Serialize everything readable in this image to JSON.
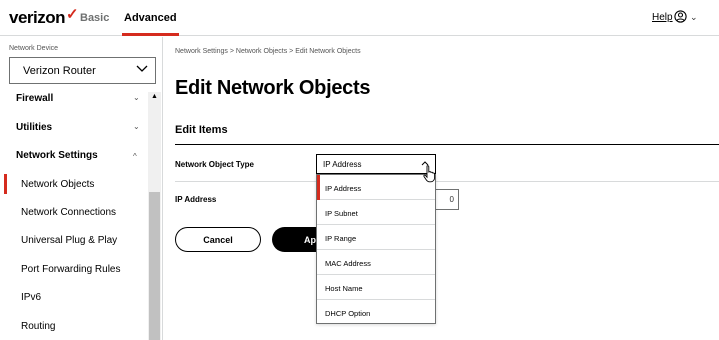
{
  "header": {
    "logo_text": "verizon",
    "logo_check": "✓",
    "tabs": [
      {
        "label": "Basic"
      },
      {
        "label": "Advanced"
      }
    ],
    "help_label": "Help",
    "user_icon": "user-circle-icon",
    "user_chevron": "⌄"
  },
  "sidebar": {
    "device_label": "Network Device",
    "device_value": "Verizon Router",
    "items": [
      {
        "label": "Firewall",
        "expanded": false
      },
      {
        "label": "Utilities",
        "expanded": false
      },
      {
        "label": "Network Settings",
        "expanded": true
      },
      {
        "label": "Network Objects",
        "active": true
      },
      {
        "label": "Network Connections"
      },
      {
        "label": "Universal Plug & Play"
      },
      {
        "label": "Port Forwarding Rules"
      },
      {
        "label": "IPv6"
      },
      {
        "label": "Routing"
      }
    ]
  },
  "main": {
    "breadcrumb": "Network Settings  >  Network Objects  >  Edit Network Objects",
    "page_title": "Edit Network Objects",
    "section_title": "Edit Items",
    "type_label": "Network Object Type",
    "type_value": "IP Address",
    "ip_label": "IP Address",
    "ip_value_tail": "0",
    "cancel_label": "Cancel",
    "apply_label": "Ap"
  },
  "dropdown": {
    "options": [
      "IP Address",
      "IP Subnet",
      "IP Range",
      "MAC Address",
      "Host Name",
      "DHCP Option"
    ],
    "selected": "IP Address"
  },
  "colors": {
    "accent": "#d52b1e",
    "border": "#d8dadb"
  }
}
